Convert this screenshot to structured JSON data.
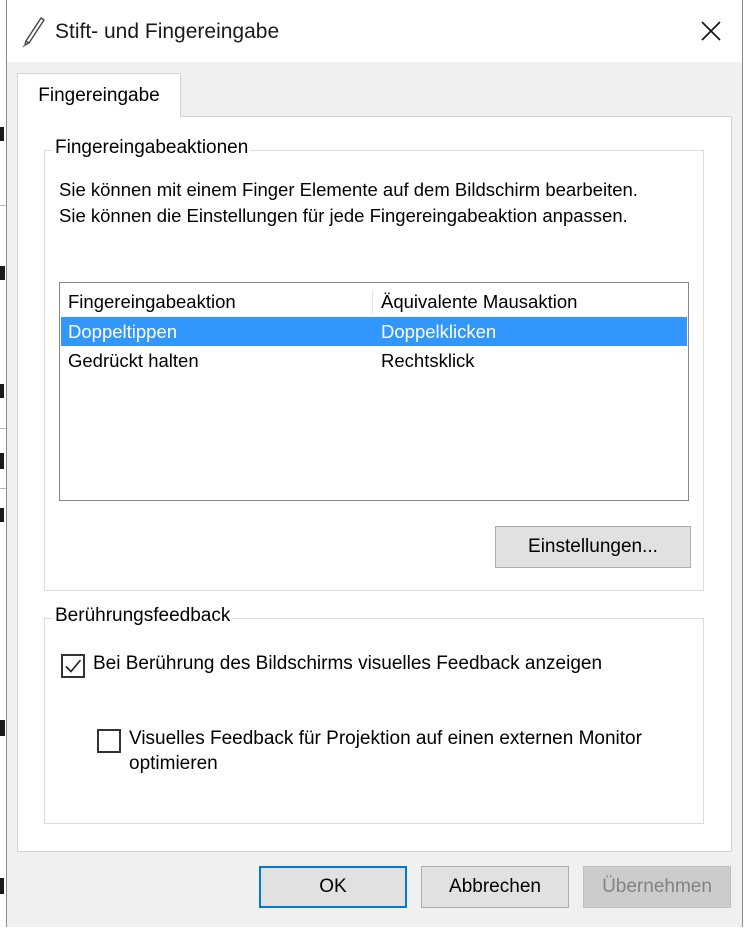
{
  "window": {
    "title": "Stift- und Fingereingabe",
    "icon": "pen-icon"
  },
  "tabs": [
    {
      "label": "Fingereingabe",
      "selected": true
    }
  ],
  "touch_actions": {
    "group_label": "Fingereingabeaktionen",
    "description": "Sie können mit einem Finger Elemente auf dem Bildschirm bearbeiten. Sie können die Einstellungen für jede Fingereingabeaktion anpassen.",
    "columns": [
      "Fingereingabeaktion",
      "Äquivalente Mausaktion"
    ],
    "rows": [
      {
        "action": "Doppeltippen",
        "mouse": "Doppelklicken",
        "selected": true
      },
      {
        "action": "Gedrückt halten",
        "mouse": "Rechtsklick",
        "selected": false
      }
    ],
    "settings_button": "Einstellungen..."
  },
  "touch_feedback": {
    "group_label": "Berührungsfeedback",
    "option_visual_feedback": {
      "label": "Bei Berührung des Bildschirms visuelles Feedback anzeigen",
      "checked": true
    },
    "option_projection": {
      "label": "Visuelles Feedback für Projektion auf einen externen Monitor optimieren",
      "checked": false
    }
  },
  "footer": {
    "ok": "OK",
    "cancel": "Abbrechen",
    "apply": "Übernehmen"
  },
  "colors": {
    "selection": "#3297fd",
    "default_button_border": "#0078d7"
  }
}
